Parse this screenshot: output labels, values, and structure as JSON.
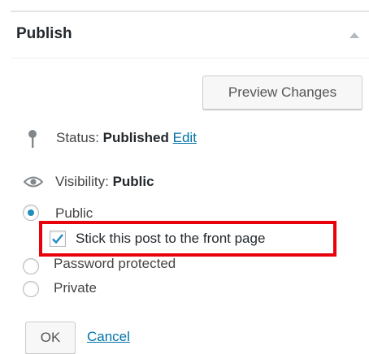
{
  "panel": {
    "title": "Publish",
    "toggle_icon": "triangle-up-icon"
  },
  "preview_button": {
    "label": "Preview Changes"
  },
  "status": {
    "label": "Status:",
    "value": "Published",
    "edit_link": "Edit",
    "icon": "pin-icon"
  },
  "visibility": {
    "label": "Visibility:",
    "value": "Public",
    "icon": "eye-icon",
    "options": [
      {
        "label": "Public",
        "selected": true
      },
      {
        "label": "Password protected",
        "selected": false
      },
      {
        "label": "Private",
        "selected": false
      }
    ],
    "sticky": {
      "label": "Stick this post to the front page",
      "checked": true
    }
  },
  "actions": {
    "ok_label": "OK",
    "cancel_label": "Cancel"
  },
  "colors": {
    "link": "#0073aa",
    "highlight_border": "#e8000b",
    "radio_dot": "#1e8cbe",
    "checkmark": "#1e8cbe"
  }
}
